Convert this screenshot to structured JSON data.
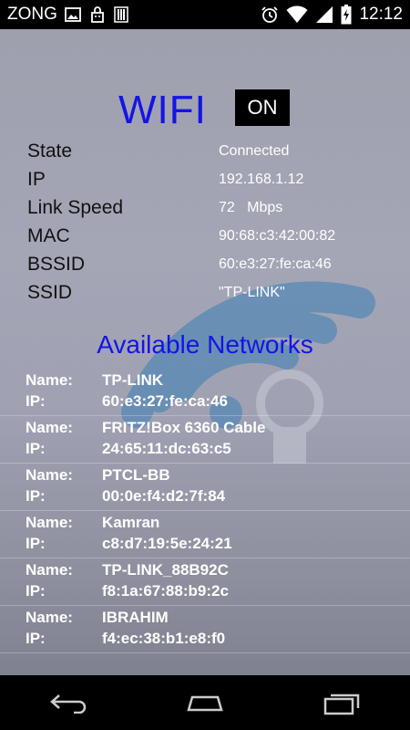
{
  "statusbar": {
    "carrier": "ZONG",
    "time": "12:12"
  },
  "header": {
    "title": "WIFI",
    "toggle_label": "ON"
  },
  "info": [
    {
      "key": "State",
      "value": "Connected"
    },
    {
      "key": "IP",
      "value": "192.168.1.12"
    },
    {
      "key": "Link Speed",
      "value": "72   Mbps"
    },
    {
      "key": "MAC",
      "value": "90:68:c3:42:00:82"
    },
    {
      "key": "BSSID",
      "value": "60:e3:27:fe:ca:46"
    },
    {
      "key": "SSID",
      "value": "\"TP-LINK\""
    }
  ],
  "available_title": "Available Networks",
  "network_labels": {
    "name": "Name:",
    "ip": "IP:"
  },
  "networks": [
    {
      "name": "TP-LINK",
      "ip": "60:e3:27:fe:ca:46"
    },
    {
      "name": "FRITZ!Box 6360 Cable",
      "ip": "24:65:11:dc:63:c5"
    },
    {
      "name": "PTCL-BB",
      "ip": "00:0e:f4:d2:7f:84"
    },
    {
      "name": "Kamran",
      "ip": "c8:d7:19:5e:24:21"
    },
    {
      "name": "TP-LINK_88B92C",
      "ip": "f8:1a:67:88:b9:2c"
    },
    {
      "name": "IBRAHIM",
      "ip": "f4:ec:38:b1:e8:f0"
    }
  ],
  "colors": {
    "accent_blue": "#1414e6",
    "background": "#a0a2b2"
  },
  "icons": {
    "statusbar": [
      "image-icon",
      "notification-bag-icon",
      "signal-bars-icon",
      "alarm-icon",
      "wifi-icon",
      "cell-signal-icon",
      "battery-charging-icon"
    ],
    "navbar": [
      "back-icon",
      "home-icon",
      "recent-apps-icon"
    ]
  }
}
